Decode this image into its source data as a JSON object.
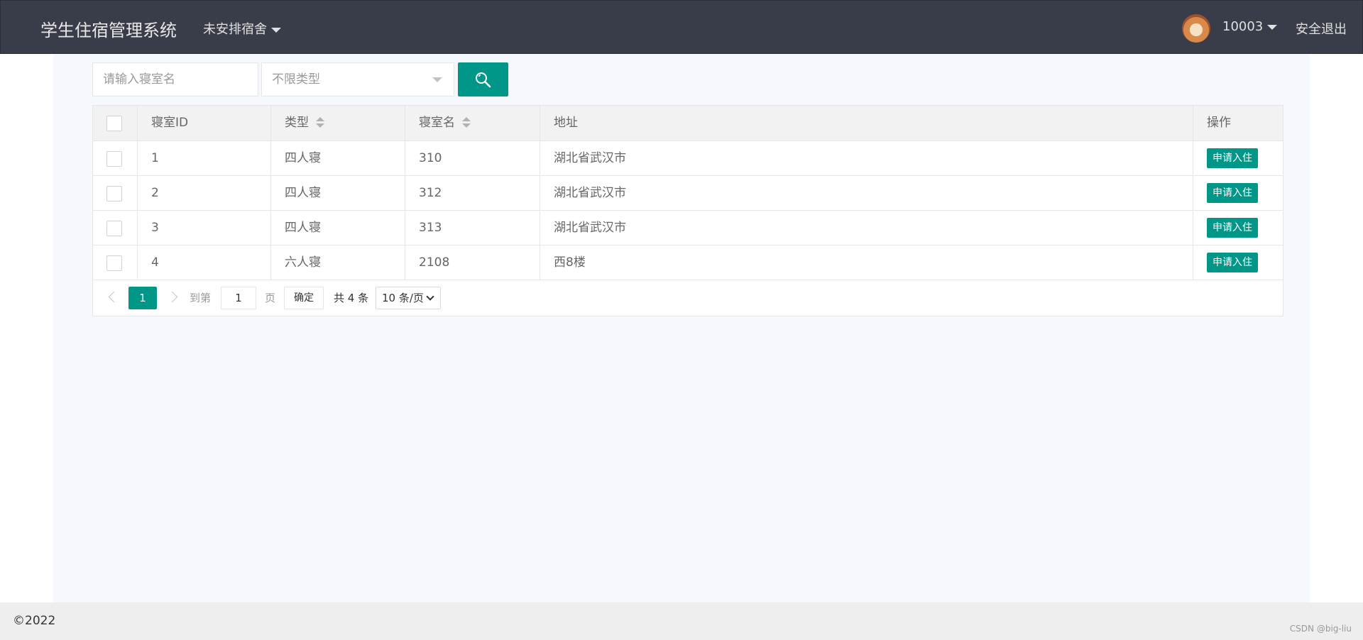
{
  "header": {
    "title": "学生住宿管理系统",
    "nav_dropdown": "未安排宿舍",
    "user_id": "10003",
    "logout": "安全退出"
  },
  "toolbar": {
    "search_placeholder": "请输入寝室名",
    "type_select_value": "不限类型",
    "search_icon": "search-icon"
  },
  "table": {
    "columns": [
      "寝室ID",
      "类型",
      "寝室名",
      "地址",
      "操作"
    ],
    "rows": [
      {
        "id": "1",
        "type": "四人寝",
        "name": "310",
        "address": "湖北省武汉市",
        "action": "申请入住"
      },
      {
        "id": "2",
        "type": "四人寝",
        "name": "312",
        "address": "湖北省武汉市",
        "action": "申请入住"
      },
      {
        "id": "3",
        "type": "四人寝",
        "name": "313",
        "address": "湖北省武汉市",
        "action": "申请入住"
      },
      {
        "id": "4",
        "type": "六人寝",
        "name": "2108",
        "address": "西8楼",
        "action": "申请入住"
      }
    ]
  },
  "pagination": {
    "current_page": "1",
    "goto_label": "到第",
    "goto_value": "1",
    "page_label": "页",
    "confirm": "确定",
    "total": "共 4 条",
    "page_size": "10 条/页"
  },
  "footer": {
    "copyright": "©2022",
    "watermark": "CSDN @big-liu"
  },
  "colors": {
    "header_bg": "#393d49",
    "accent": "#009688",
    "main_bg": "#f5f9fd",
    "footer_bg": "#eeeeee"
  }
}
